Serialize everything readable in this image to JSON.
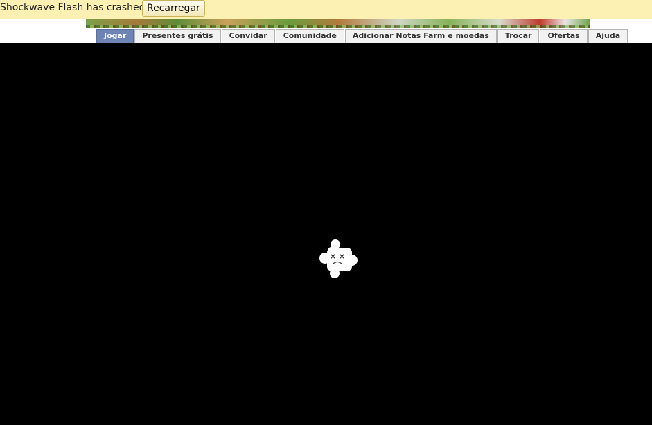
{
  "infobar": {
    "message": "Shockwave Flash has crashed.",
    "reload_label": "Recarregar"
  },
  "tabs": [
    {
      "label": "Jogar",
      "active": true
    },
    {
      "label": "Presentes grátis",
      "active": false
    },
    {
      "label": "Convidar",
      "active": false
    },
    {
      "label": "Comunidade",
      "active": false
    },
    {
      "label": "Adicionar Notas Farm e moedas",
      "active": false
    },
    {
      "label": "Trocar",
      "active": false
    },
    {
      "label": "Ofertas",
      "active": false
    },
    {
      "label": "Ajuda",
      "active": false
    }
  ],
  "plugin": {
    "icon": "sad-plugin-icon",
    "background_color": "#000000"
  },
  "colors": {
    "infobar_bg": "#fdf0b3",
    "active_tab": "#6d84b4"
  }
}
